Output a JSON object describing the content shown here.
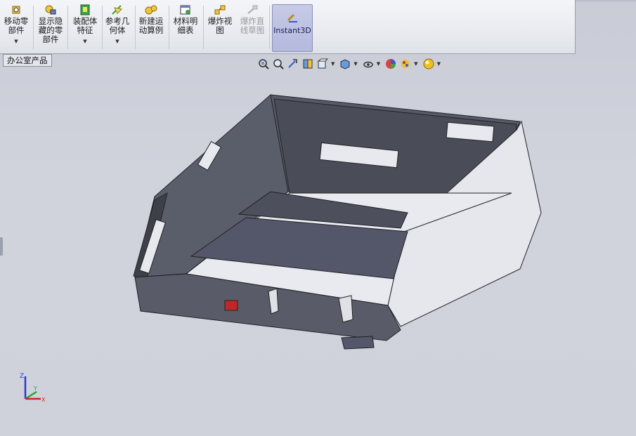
{
  "toolbar": {
    "items": [
      {
        "label": "移动零部件",
        "line1": "移动零",
        "line2": "部件",
        "has_menu": true,
        "icon": "move-component-icon"
      },
      {
        "label": "显示隐藏的零部件",
        "line1": "显示隐",
        "line2": "藏的零",
        "line3": "部件",
        "icon": "show-hidden-components-icon"
      },
      {
        "label": "装配体特征",
        "line1": "装配体",
        "line2": "特征",
        "has_menu": true,
        "icon": "assembly-features-icon"
      },
      {
        "label": "参考几何体",
        "line1": "参考几",
        "line2": "何体",
        "has_menu": true,
        "icon": "reference-geometry-icon"
      },
      {
        "label": "新建运动算例",
        "line1": "新建运",
        "line2": "动算例",
        "icon": "new-motion-study-icon"
      },
      {
        "label": "材料明细表",
        "line1": "材料明",
        "line2": "细表",
        "icon": "bill-of-materials-icon"
      },
      {
        "label": "爆炸视图",
        "line1": "爆炸视",
        "line2": "图",
        "icon": "exploded-view-icon"
      },
      {
        "label": "爆炸直线草图",
        "line1": "爆炸直",
        "line2": "线草图",
        "disabled": true,
        "icon": "explode-line-sketch-icon"
      }
    ],
    "instant3d": {
      "label": "Instant3D",
      "active": true,
      "icon": "instant3d-icon"
    }
  },
  "tabs": {
    "office_products": "办公室产品"
  },
  "heads_up_toolbar": [
    "zoom-to-fit-icon",
    "zoom-to-area-icon",
    "previous-view-icon",
    "section-view-icon",
    "view-orientation-icon",
    "display-style-icon",
    "hide-show-items-icon",
    "edit-appearance-icon",
    "apply-scene-icon",
    "view-settings-icon"
  ],
  "triad": {
    "x": "X",
    "y": "Y",
    "z": "Z"
  },
  "colors": {
    "background": "#cfd2db",
    "toolbar": "#eceef2",
    "model_dark": "#4a4c58",
    "model_light": "#e8e9ee",
    "instant3d_active": "#bcc0e2"
  }
}
